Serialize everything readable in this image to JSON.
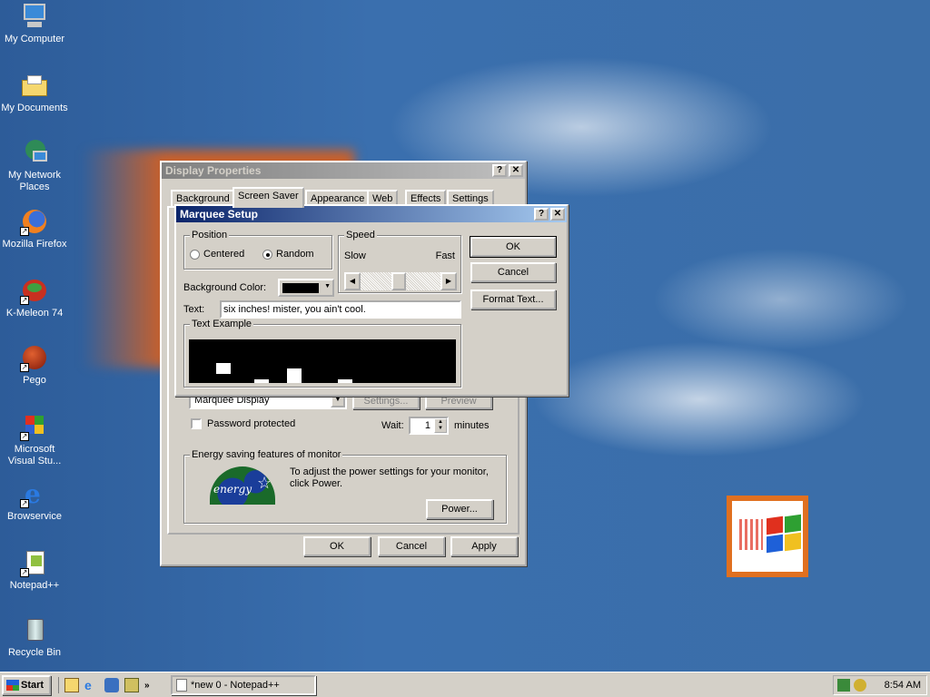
{
  "desktop": {
    "icons": [
      "My Computer",
      "My Documents",
      "My Network Places",
      "Mozilla Firefox",
      "K-Meleon 74",
      "Pego",
      "Microsoft Visual Stu...",
      "Browservice",
      "Notepad++",
      "Recycle Bin"
    ]
  },
  "display_props": {
    "title": "Display Properties",
    "help": "?",
    "close": "✕",
    "tabs": [
      "Background",
      "Screen Saver",
      "Appearance",
      "Web",
      "Effects",
      "Settings"
    ],
    "screensaver_value": "Marquee Display",
    "settings_label": "Settings...",
    "preview_label": "Preview",
    "password_label": "Password protected",
    "wait_label": "Wait:",
    "wait_value": "1",
    "minutes_label": "minutes",
    "energy_legend": "Energy saving features of monitor",
    "energy_text": "To adjust the power settings for your monitor, click Power.",
    "power_label": "Power...",
    "ok": "OK",
    "cancel": "Cancel",
    "apply": "Apply"
  },
  "marquee": {
    "title": "Marquee Setup",
    "position_legend": "Position",
    "centered": "Centered",
    "random": "Random",
    "speed_legend": "Speed",
    "slow": "Slow",
    "fast": "Fast",
    "bg_color_label": "Background Color:",
    "text_label": "Text:",
    "text_value": "six inches! mister, you ain't cool.",
    "example_legend": "Text Example",
    "ok": "OK",
    "cancel": "Cancel",
    "format": "Format Text..."
  },
  "taskbar": {
    "start": "Start",
    "task": "*new  0 - Notepad++",
    "time": "8:54 AM"
  }
}
